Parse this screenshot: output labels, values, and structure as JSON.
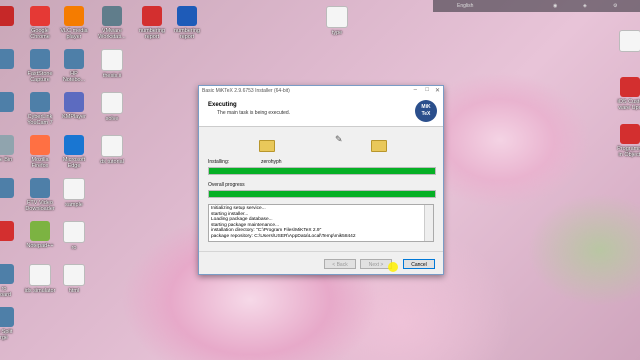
{
  "desktop": {
    "col1": [
      {
        "label": "",
        "icon": "adobe-icon"
      },
      {
        "label": "",
        "icon": "app-icon"
      },
      {
        "label": "",
        "icon": "app-icon"
      },
      {
        "label": "cle Bin",
        "icon": "recycle-bin-icon"
      },
      {
        "label": "",
        "icon": "app-icon"
      },
      {
        "label": "",
        "icon": "pdf-icon"
      },
      {
        "label": "ro\nboard",
        "icon": "app-icon"
      },
      {
        "label": "rs Split\nrge",
        "icon": "app-icon"
      }
    ],
    "col2": [
      {
        "label": "Google\nChrome",
        "icon": "chrome-icon"
      },
      {
        "label": "FastStone\nCapture",
        "icon": "app-icon"
      },
      {
        "label": "CyberLink\nYouCam 7",
        "icon": "app-icon"
      },
      {
        "label": "Mozilla\nFirefox",
        "icon": "firefox-icon"
      },
      {
        "label": "FTV Video\nDownloader",
        "icon": "app-icon"
      },
      {
        "label": "Notepad++",
        "icon": "notepad-icon"
      },
      {
        "label": "ids simulator",
        "icon": "file-icon"
      }
    ],
    "col3": [
      {
        "label": "VLC media\nplayer",
        "icon": "vlc-icon"
      },
      {
        "label": "HP\nNotebo...",
        "icon": "app-icon"
      },
      {
        "label": "KMPlayer",
        "icon": "kmp-icon"
      },
      {
        "label": "Microsoft\nEdge",
        "icon": "edge-icon"
      },
      {
        "label": "sample",
        "icon": "file-icon"
      },
      {
        "label": "ro",
        "icon": "file-icon"
      },
      {
        "label": "html",
        "icon": "file-icon"
      }
    ],
    "col4": [
      {
        "label": "VMware\nWorkstati...",
        "icon": "vmware-icon"
      },
      {
        "label": "thesis.ii",
        "icon": "file-icon"
      },
      {
        "label": "solve",
        "icon": "file-icon"
      },
      {
        "label": "ds tutorial",
        "icon": "file-icon"
      }
    ],
    "col5": [
      {
        "label": "numbering\nreport",
        "icon": "pdf-icon"
      }
    ],
    "col6": [
      {
        "label": "numbering\nreport",
        "icon": "word-icon"
      }
    ],
    "right": [
      {
        "label": "",
        "icon": "file-icon"
      },
      {
        "label": "iOS Custo\nware Upd",
        "icon": "pdf-icon"
      },
      {
        "label": "Programm\nin Objecti",
        "icon": "pdf-icon"
      }
    ],
    "top_right": {
      "label": "type"
    }
  },
  "topbar": {
    "lang": "English"
  },
  "dialog": {
    "title": "Basic MiKTeX 2.9.6753 Installer (64-bit)",
    "heading": "Executing",
    "subheading": "The main task is being executed.",
    "logo_line1": "MiK",
    "logo_line2": "TeX",
    "installing_label": "Installing:",
    "installing_value": "zerohyph",
    "installing_progress": 1.0,
    "overall_label": "Overall progress",
    "overall_progress": 1.0,
    "log_lines": [
      "Initializing setup service...",
      "starting installer...",
      "Loading package database...",
      "starting package maintenance...",
      "installation directory: \"C:\\Program Files\\MiKTeX 2.9\"",
      "package repository: C:\\Users\\USER\\AppData\\Local\\Temp\\mik58442"
    ],
    "back_label": "< Back",
    "next_label": "Next >",
    "cancel_label": "Cancel"
  },
  "colors": {
    "progress": "#06b025",
    "accent": "#0078d7"
  }
}
